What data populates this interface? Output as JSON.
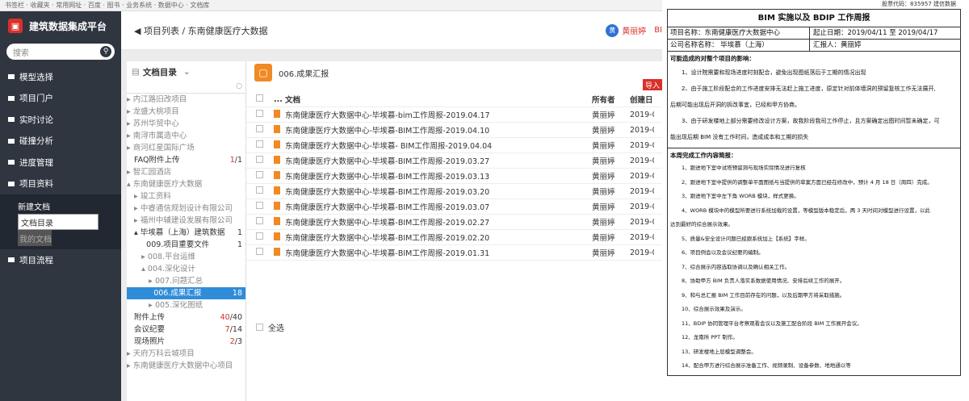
{
  "topbar": {
    "text": "书签栏 · 收藏夹 · 常用网址 · 百度 · 图书 · 业务系统 · 数据中心 · 文档库"
  },
  "sidebar": {
    "brand": "建筑数据集成平台",
    "search_placeholder": "搜索",
    "items": [
      {
        "label": "模型选择"
      },
      {
        "label": "项目门户"
      },
      {
        "label": "实时讨论"
      },
      {
        "label": "碰撞分析"
      },
      {
        "label": "进度管理"
      },
      {
        "label": "项目资料"
      }
    ],
    "sub_items": [
      {
        "label": "新建文档"
      },
      {
        "label": "文档目录"
      },
      {
        "label": "我的文档"
      }
    ],
    "last_item": "项目流程"
  },
  "header": {
    "breadcrumb": "◀ 项目列表 / 东南健康医疗大数据",
    "user_name": "黄丽婷",
    "user_initial": "黄",
    "user_extra": "BI"
  },
  "tree": {
    "title": "文档目录",
    "nodes": [
      {
        "label": "▸ 内江路旧改项目",
        "count": "",
        "style": "gray"
      },
      {
        "label": "▸ 龙盛大桃项目",
        "count": "",
        "style": "gray"
      },
      {
        "label": "▸ 苏州华贸中心",
        "count": "",
        "style": "gray"
      },
      {
        "label": "▸ 南浔市属造中心",
        "count": "",
        "style": "gray"
      },
      {
        "label": "▸ 商河红星国际广场",
        "count": "",
        "style": "gray"
      },
      {
        "label": "   FAQ附件上传",
        "count_num": "1",
        "count_den": "/1",
        "style": "dark"
      },
      {
        "label": "▸ 智汇园酒店",
        "count": "",
        "style": "gray"
      },
      {
        "label": "▴ 东南健康医疗大数据",
        "count": "",
        "style": "gray"
      },
      {
        "label": "   ▸ 竣工资料",
        "count": "",
        "style": "gray"
      },
      {
        "label": "   ▸ 中睿通信规划设计有限公司",
        "count": "",
        "style": "gray"
      },
      {
        "label": "   ▸ 福州中辅建设发展有限公司",
        "count": "",
        "style": "gray"
      },
      {
        "label": "   ▴ 毕埃慕（上海）建筑数据",
        "count_plain": "1",
        "style": "dark"
      },
      {
        "label": "        009.项目重要文件",
        "count_plain": "1",
        "style": "dark"
      },
      {
        "label": "      ▸ 008.平台运维",
        "count": "",
        "style": "gray"
      },
      {
        "label": "      ▴ 004.深化设计",
        "count": "",
        "style": "gray"
      },
      {
        "label": "         ▸ 007.问题汇总",
        "count": "",
        "style": "gray"
      },
      {
        "label": "           006.成果汇报",
        "count_plain": "18",
        "style": "sel"
      },
      {
        "label": "         ▸ 005.深化图纸",
        "count": "",
        "style": "gray"
      },
      {
        "label": "   附件上传",
        "count_num": "40",
        "count_den": "/40",
        "style": "dark"
      },
      {
        "label": "   会议纪要",
        "count_num": "7",
        "count_den": "/14",
        "style": "dark"
      },
      {
        "label": "   现场照片",
        "count_num": "2",
        "count_den": "/3",
        "style": "dark"
      },
      {
        "label": "▸ 天府万科云城项目",
        "count": "",
        "style": "gray"
      },
      {
        "label": "▸ 东南健康医疗大数据中心项目",
        "count": "",
        "style": "gray"
      }
    ]
  },
  "files": {
    "folder": "006.成果汇报",
    "export": "导入",
    "headers": {
      "dots": "...",
      "name": "文档",
      "owner": "所有者",
      "date": "创建日"
    },
    "rows": [
      {
        "name": "东南健康医疗大数据中心-毕埃慕-bim工作周报-2019.04.17",
        "owner": "黄丽婷",
        "date": "2019-0"
      },
      {
        "name": "东南健康医疗大数据中心-毕埃慕-BIM工作周报-2019.04.10",
        "owner": "黄丽婷",
        "date": "2019-0"
      },
      {
        "name": "东南健康医疗大数据中心-毕埃慕- BIM工作周报-2019.04.04",
        "owner": "黄丽婷",
        "date": "2019-0"
      },
      {
        "name": "东南健康医疗大数据中心-毕埃慕-BIM工作周报-2019.03.27",
        "owner": "黄丽婷",
        "date": "2019-0"
      },
      {
        "name": "东南健康医疗大数据中心-毕埃慕-BIM工作周报-2019.03.13",
        "owner": "黄丽婷",
        "date": "2019-0"
      },
      {
        "name": "东南健康医疗大数据中心-毕埃慕-BIM工作周报-2019.03.20",
        "owner": "黄丽婷",
        "date": "2019-0"
      },
      {
        "name": "东南健康医疗大数据中心-毕埃慕-BIM工作周报-2019.03.07",
        "owner": "黄丽婷",
        "date": "2019-0"
      },
      {
        "name": "东南健康医疗大数据中心-毕埃慕-BIM工作周报-2019.02.27",
        "owner": "黄丽婷",
        "date": "2019-0"
      },
      {
        "name": "东南健康医疗大数据中心-毕埃慕-BIM工作周报-2019.02.20",
        "owner": "黄丽婷",
        "date": "2019-0"
      },
      {
        "name": "东南健康医疗大数据中心-毕埃慕-BIM工作周报-2019.01.31",
        "owner": "黄丽婷",
        "date": "2019-0"
      }
    ],
    "select_all": "全选"
  },
  "report": {
    "code": "股票代码：835957 建信数据",
    "title": "BIM 实施以及 BDIP 工作周报",
    "project_label": "项目名称：东南健康医疗大数据中心",
    "date_label": "起止日期：2019/04/11 至 2019/04/17",
    "company_label": "公司名称名称： 毕埃慕（上海）",
    "reporter_label": "汇报人：黄丽婷",
    "impact_head": "可能造成的对整个项目的影响：",
    "impact": [
      "1、设计院需要和现场进度时刻配合，避免出现图纸落后于工期的情况出现",
      "2、由于施工阶段配合的工作进度安排无法赶上施工进度，原定针对前体墙洞的预留复核工作无法展开,",
      "后期可能出现后开洞的拆改事宜，已经和甲方协商。",
      "3、由于研发楼地上部分需要修改设计方案，故我阶段我司工作停止，且方案确定出图时间暂未确定，可",
      "能出现后期 BIM 没有工作时间，造成成本和工期的损失"
    ],
    "done_head": "本周完成工作内容简报：",
    "done": [
      "1、跟进地下室中试塔预留洞与现场实际情况进行复核",
      "2、跟进地下室中提供的调整单平面图纸与当提供的草案方面已经在修改中，预计 4 月 18 日（周四）完成。",
      "3、跟进地下室中左下角 WORB 模块，样式更换。",
      "4、WORB 模块中的模型所要进行系统加载的设置，等模型版本稳定后，两 3 天时间对模型进行设置，以此",
      "达到最好的综合展示效果。",
      "5、质量&安全设计问题已经跟系统加上【系统】字样。",
      "6、项目例会以及会议纪要的编制。",
      "7、综合展示内容选取协调以及确认相关工作。",
      "8、协助甲方 BIM 负责人落实系数据使用情况、安排后续工作的展开。",
      "9、和与总汇报 BIM 工作目前存在的问题，以及后期甲方将采取措施。",
      "10、综合展示效果及演示。",
      "11、BDIP 协同管理平台考察观看会议以及施工配合阶段 BIM 工作展开会议。",
      "12、龙南所 PPT 制作。",
      "13、研发楼地上层模型调整会。",
      "14、配合甲方进行综合展示准备工作、视频录制、设备参数、地地通以等"
    ]
  }
}
